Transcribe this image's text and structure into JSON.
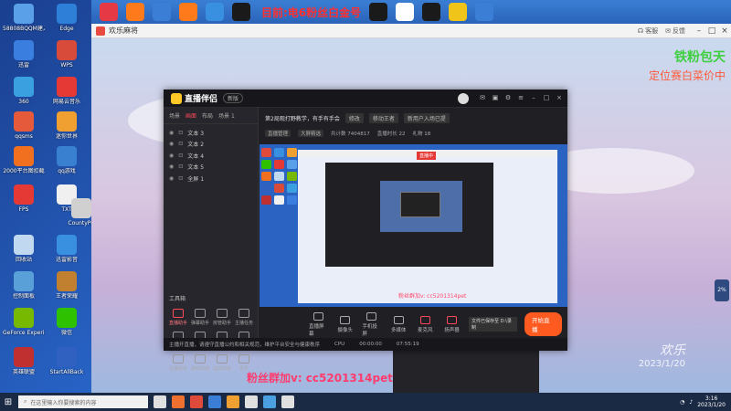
{
  "desktop": {
    "icons": [
      {
        "label": "58808BQQM建入直播间",
        "color": "#5aa0e8"
      },
      {
        "label": "Edge",
        "color": "#2e7fd8"
      },
      {
        "label": "迅雷",
        "color": "#3a7fe0"
      },
      {
        "label": "WPS",
        "color": "#d84a3a"
      },
      {
        "label": "360",
        "color": "#3aa0e0"
      },
      {
        "label": "网易云音乐",
        "color": "#e53935"
      },
      {
        "label": "qqsms",
        "color": "#e55a3a"
      },
      {
        "label": "迷你世界",
        "color": "#f0a030"
      },
      {
        "label": "2000平台图扣截",
        "color": "#f07020"
      },
      {
        "label": "qq游戏",
        "color": "#3a80d0"
      },
      {
        "label": "FPS",
        "color": "#e53935"
      },
      {
        "label": "TXT",
        "color": "#f0f0f0"
      },
      {
        "label": "CountyPC",
        "color": "#d0d0d0"
      },
      {
        "label": "回收站",
        "color": "#c0d8f0"
      },
      {
        "label": "迅雷影音",
        "color": "#3a90e0"
      },
      {
        "label": "控制面板",
        "color": "#5aa0d8"
      },
      {
        "label": "王者荣耀",
        "color": "#c08030"
      },
      {
        "label": "GeForce Experience",
        "color": "#76b900"
      },
      {
        "label": "微信",
        "color": "#2dc100"
      },
      {
        "label": "英雄联盟",
        "color": "#c03030"
      },
      {
        "label": "StartAllBack",
        "color": "#3060c0"
      }
    ]
  },
  "top_bar": {
    "title": "目前:电6粉丝白金号",
    "icons": [
      "#e63946",
      "#ff7a1a",
      "#3a7fd5",
      "#ff7a1a",
      "#3a90e0",
      "#1a1a1a",
      "#1a1a1a",
      "#ffffff",
      "#1a1a1a",
      "#f0c419",
      "#3a7fd5"
    ]
  },
  "app": {
    "title": "欢乐麻将",
    "btn_store": "客服",
    "btn_feedback": "反馈"
  },
  "watermarks": {
    "green": "铁粉包天",
    "red": "定位赛白菜价中",
    "bottom": "粉丝群加v: cc5201314pet",
    "logo_big": "欢乐",
    "logo_date": "2023/1/20"
  },
  "streamer": {
    "logo": "直播伴侣",
    "version": "新版",
    "tabs": [
      "场景",
      "画面",
      "布局",
      "场景 1"
    ],
    "scenes": [
      "文本 3",
      "文本 2",
      "文本 4",
      "文本 5",
      "全屏 1"
    ],
    "tools_title": "工具箱",
    "tools": [
      {
        "label": "直播助手",
        "hot": true
      },
      {
        "label": "弹幕助手",
        "hot": false
      },
      {
        "label": "房管助手",
        "hot": false
      },
      {
        "label": "主播任务",
        "hot": false
      },
      {
        "label": "人气连麦",
        "hot": false
      },
      {
        "label": "加入连麦",
        "hot": false
      },
      {
        "label": "连麦PK",
        "hot": false
      },
      {
        "label": "主播礼物",
        "hot": false
      },
      {
        "label": "主播任务",
        "hot": false
      },
      {
        "label": "游戏商城",
        "hot": false
      },
      {
        "label": "虚拟形象",
        "hot": false
      },
      {
        "label": "更多",
        "hot": false
      }
    ],
    "topic": "第2局观打野教学，有手有手会",
    "topic_chip1": "修改",
    "topic_chip2": "移动王者",
    "topic_chip3": "新用户入场已提",
    "meta": [
      "直播管理",
      "大屏精选",
      "共计数 7404817",
      "直播时长 22",
      "礼物 18"
    ],
    "preview_label": "直播中",
    "preview_watermark": "粉丝群加v: cc5201314pet",
    "bottom_tools": [
      {
        "label": "直播屏幕",
        "hot": false
      },
      {
        "label": "摄像头",
        "hot": false
      },
      {
        "label": "手机投屏",
        "hot": false
      },
      {
        "label": "多媒体",
        "hot": false
      },
      {
        "label": "麦克风",
        "hot": true
      },
      {
        "label": "扬声器",
        "hot": true
      }
    ],
    "audio_chip": "文件已保存至 D:\\录制",
    "start_live": "开始直播",
    "status": [
      "主播开直播，请遵守直播公约和相关规范，维护平台安全与健康秩序",
      "CPU",
      "00:00:00",
      "07:55:19"
    ]
  },
  "taskbar": {
    "search_placeholder": "在这里输入你要搜索的内容",
    "apps": [
      "#e0e0e0",
      "#f07030",
      "#e04a3a",
      "#3a7fd5",
      "#f0a030",
      "#e0e0e0",
      "#4aa0e0",
      "#e0e0e0"
    ],
    "time": "3:16",
    "date": "2023/1/20"
  },
  "side_badge": "2%"
}
